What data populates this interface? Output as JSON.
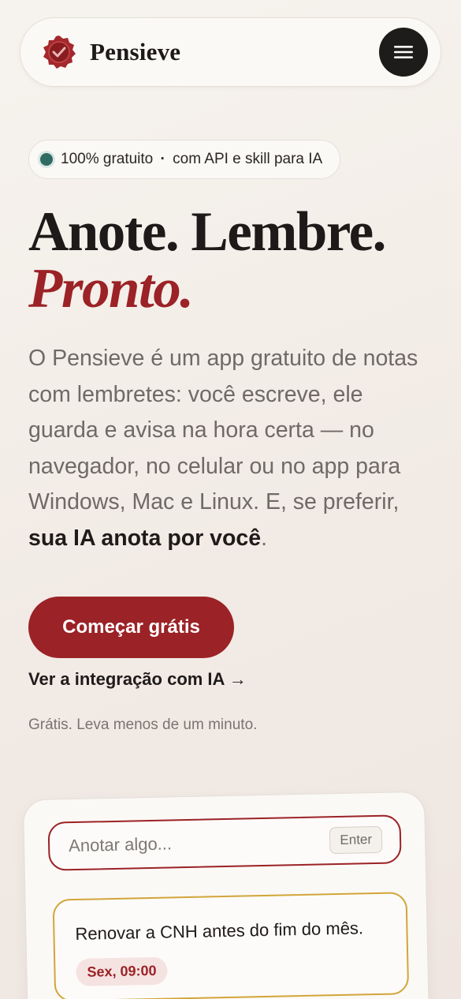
{
  "header": {
    "brand_name": "Pensieve",
    "logo_icon": "wax-seal-check-icon",
    "menu_icon": "hamburger-menu-icon"
  },
  "badge": {
    "part1": "100% gratuito",
    "separator": "·",
    "part2": "com API e skill para IA"
  },
  "hero": {
    "title_line1": "Anote. Lembre.",
    "title_line2": "Pronto.",
    "lead_text": "O Pensieve é um app gratuito de notas com lembretes: você escreve, ele guarda e avisa na hora certa — no navegador, no celular ou no app para Windows, Mac e Linux. E, se preferir, ",
    "lead_bold": "sua IA anota por você",
    "lead_end": "."
  },
  "cta": {
    "primary_label": "Começar grátis",
    "secondary_label": "Ver a integração com IA →",
    "note": "Grátis. Leva menos de um minuto."
  },
  "demo": {
    "input_placeholder": "Anotar algo...",
    "enter_label": "Enter",
    "note_text": "Renovar a CNH antes do fim do mês.",
    "note_time": "Sex, 09:00"
  },
  "colors": {
    "accent": "#9b2226",
    "highlight_border": "#d2a53a",
    "badge_dot": "#2f6b63",
    "dark": "#1e1c1b"
  }
}
